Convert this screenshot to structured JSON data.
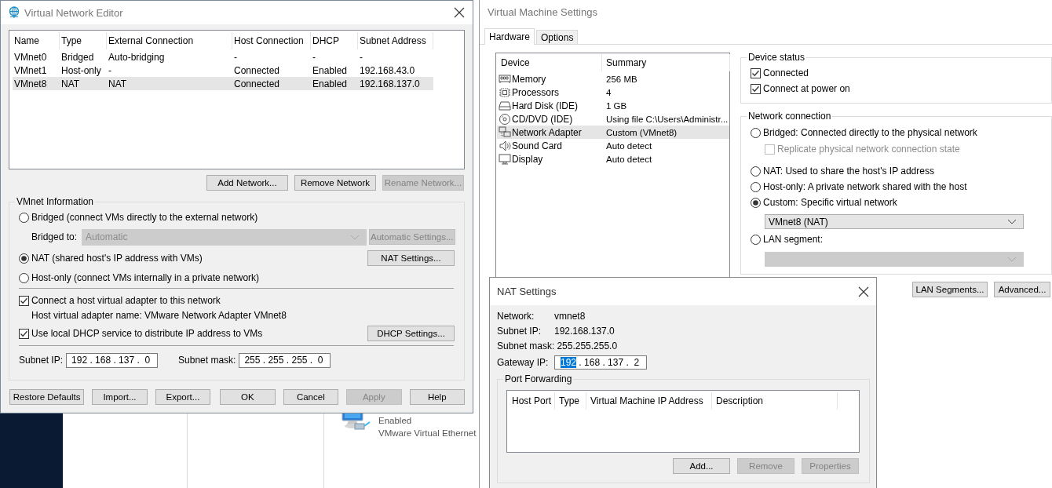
{
  "background_window": {
    "status": "Enabled",
    "description": "VMware Virtual Ethernet"
  },
  "network_editor": {
    "title": "Virtual Network Editor",
    "networks": {
      "columns": [
        "Name",
        "Type",
        "External Connection",
        "Host Connection",
        "DHCP",
        "Subnet Address"
      ],
      "rows": [
        {
          "cells": [
            "VMnet0",
            "Bridged",
            "Auto-bridging",
            "-",
            "-",
            "-"
          ],
          "selected": false
        },
        {
          "cells": [
            "VMnet1",
            "Host-only",
            "-",
            "Connected",
            "Enabled",
            "192.168.43.0"
          ],
          "selected": false
        },
        {
          "cells": [
            "VMnet8",
            "NAT",
            "NAT",
            "Connected",
            "Enabled",
            "192.168.137.0"
          ],
          "selected": true
        }
      ]
    },
    "list_buttons": [
      {
        "label": "Add Network...",
        "disabled": false
      },
      {
        "label": "Remove Network",
        "disabled": false
      },
      {
        "label": "Rename Network...",
        "disabled": true
      }
    ],
    "vmnet_info": {
      "title": "VMnet Information",
      "bridged": {
        "label": "Bridged (connect VMs directly to the external network)",
        "selected": false
      },
      "bridged_to": {
        "label": "Bridged to:",
        "value": "Automatic",
        "disabled": true
      },
      "automatic_settings": {
        "label": "Automatic Settings...",
        "disabled": true
      },
      "nat": {
        "label": "NAT (shared host's IP address with VMs)",
        "selected": true
      },
      "nat_settings": {
        "label": "NAT Settings...",
        "disabled": false
      },
      "host_only": {
        "label": "Host-only (connect VMs internally in a private network)",
        "selected": false
      },
      "connect_adapter": {
        "label": "Connect a host virtual adapter to this network",
        "checked": true
      },
      "adapter_name": "Host virtual adapter name: VMware Network Adapter VMnet8",
      "use_dhcp": {
        "label": "Use local DHCP service to distribute IP address to VMs",
        "checked": true
      },
      "dhcp_settings": {
        "label": "DHCP Settings...",
        "disabled": false
      },
      "subnet_ip": {
        "label": "Subnet IP:",
        "value": "192 . 168 . 137 .  0"
      },
      "subnet_mask": {
        "label": "Subnet mask:",
        "value": "255 . 255 . 255 .  0"
      }
    },
    "footer_buttons": [
      {
        "label": "Restore Defaults",
        "disabled": false
      },
      {
        "label": "Import...",
        "disabled": false
      },
      {
        "label": "Export...",
        "disabled": false
      },
      {
        "label": "OK",
        "disabled": false
      },
      {
        "label": "Cancel",
        "disabled": false
      },
      {
        "label": "Apply",
        "disabled": true
      },
      {
        "label": "Help",
        "disabled": false
      }
    ]
  },
  "vm_settings": {
    "title": "Virtual Machine Settings",
    "tabs": [
      {
        "label": "Hardware",
        "selected": true
      },
      {
        "label": "Options",
        "selected": false
      }
    ],
    "devices": {
      "columns": [
        "Device",
        "Summary"
      ],
      "rows": [
        {
          "device": "Memory",
          "summary": "256 MB",
          "selected": false
        },
        {
          "device": "Processors",
          "summary": "4",
          "selected": false
        },
        {
          "device": "Hard Disk (IDE)",
          "summary": "1 GB",
          "selected": false
        },
        {
          "device": "CD/DVD (IDE)",
          "summary": "Using file C:\\Users\\Administr...",
          "selected": false
        },
        {
          "device": "Network Adapter",
          "summary": "Custom (VMnet8)",
          "selected": true
        },
        {
          "device": "Sound Card",
          "summary": "Auto detect",
          "selected": false
        },
        {
          "device": "Display",
          "summary": "Auto detect",
          "selected": false
        }
      ]
    },
    "device_status": {
      "title": "Device status",
      "options": [
        {
          "label": "Connected",
          "checked": true
        },
        {
          "label": "Connect at power on",
          "checked": true
        }
      ]
    },
    "network_connection": {
      "title": "Network connection",
      "items": [
        {
          "kind": "radio",
          "label": "Bridged: Connected directly to the physical network",
          "selected": false
        },
        {
          "kind": "checkbox",
          "label": "Replicate physical network connection state",
          "checked": false,
          "disabled": true
        },
        {
          "kind": "radio",
          "label": "NAT: Used to share the host's IP address",
          "selected": false
        },
        {
          "kind": "radio",
          "label": "Host-only: A private network shared with the host",
          "selected": false
        },
        {
          "kind": "radio",
          "label": "Custom: Specific virtual network",
          "selected": true
        },
        {
          "kind": "dropdown",
          "value": "VMnet8 (NAT)",
          "disabled": false
        },
        {
          "kind": "radio",
          "label": "LAN segment:",
          "selected": false
        },
        {
          "kind": "dropdown",
          "disabled": true
        }
      ]
    },
    "buttons": [
      {
        "label": "LAN Segments...",
        "disabled": false
      },
      {
        "label": "Advanced...",
        "disabled": false
      }
    ]
  },
  "nat_settings": {
    "title": "NAT Settings",
    "info": [
      {
        "label": "Network:",
        "value": "vmnet8"
      },
      {
        "label": "Subnet IP:",
        "value": "192.168.137.0"
      },
      {
        "label": "Subnet mask:",
        "value": "255.255.255.0"
      }
    ],
    "gateway": {
      "label": "Gateway IP:",
      "selection": "192",
      "rest": " . 168 . 137 .  2"
    },
    "port_forwarding": {
      "title": "Port Forwarding",
      "columns": [
        "Host Port",
        "Type",
        "Virtual Machine IP Address",
        "Description"
      ]
    },
    "buttons": [
      {
        "label": "Add...",
        "disabled": false
      },
      {
        "label": "Remove",
        "disabled": true
      },
      {
        "label": "Properties",
        "disabled": true
      }
    ]
  }
}
